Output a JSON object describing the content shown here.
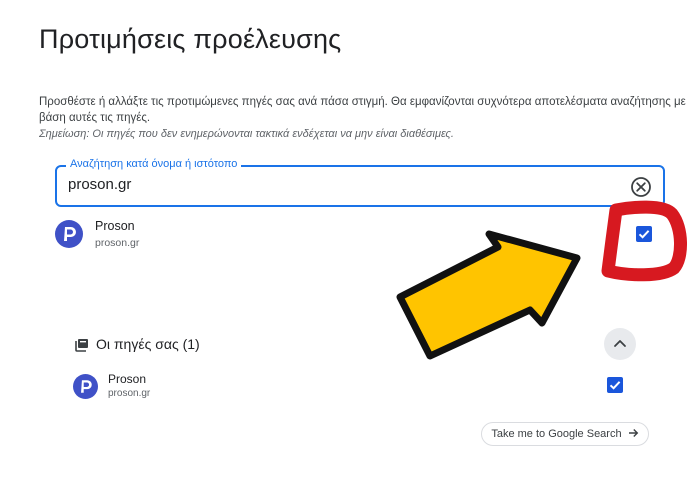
{
  "page": {
    "title": "Προτιμήσεις προέλευσης",
    "description": "Προσθέστε ή αλλάξτε τις προτιμώμενες πηγές σας ανά πάσα στιγμή. Θα εμφανίζονται συχνότερα αποτελέσματα αναζήτησης με βάση αυτές τις πηγές.",
    "note": "Σημείωση: Οι πηγές που δεν ενημερώνονται τακτικά ενδέχεται να μην είναι διαθέσιμες."
  },
  "search": {
    "label": "Αναζήτηση κατά όνομα ή ιστότοπο",
    "value": "proson.gr"
  },
  "search_result": {
    "name": "Proson",
    "domain": "proson.gr",
    "checked": true
  },
  "your_sources": {
    "title": "Οι πηγές σας (1)",
    "items": [
      {
        "name": "Proson",
        "domain": "proson.gr",
        "checked": true
      }
    ]
  },
  "google_button": {
    "label": "Take me to Google Search"
  },
  "colors": {
    "accent": "#1a73e8",
    "checkbox": "#1a56db",
    "arrow_fill": "#ffc400",
    "highlight_red": "#d71920"
  },
  "icons": [
    "clear-icon",
    "proson-logo-icon",
    "collections-icon",
    "chevron-up-icon",
    "arrow-right-icon"
  ]
}
